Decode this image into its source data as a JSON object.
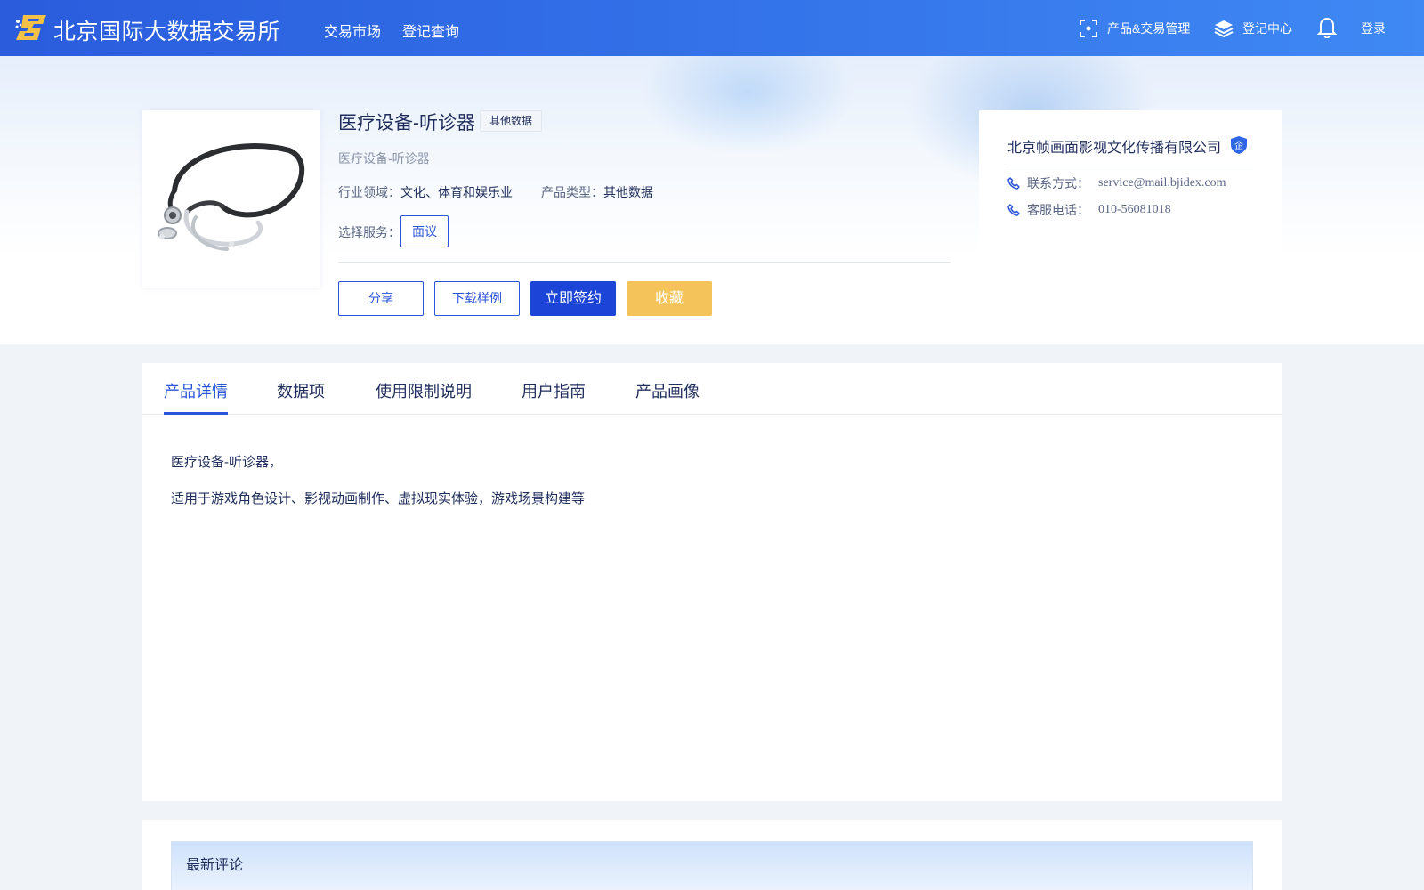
{
  "header": {
    "brand": "北京国际大数据交易所",
    "nav": [
      "交易市场",
      "登记查询"
    ],
    "product_mgmt": "产品&交易管理",
    "registry_center": "登记中心",
    "login": "登录",
    "colors": {
      "header_start": "#2a5cdc",
      "header_end": "#3f89f4"
    }
  },
  "product": {
    "title": "医疗设备-听诊器",
    "tag": "其他数据",
    "subtitle": "医疗设备-听诊器",
    "industry_label": "行业领域：",
    "industry_value": "文化、体育和娱乐业",
    "type_label": "产品类型：",
    "type_value": "其他数据",
    "service_label": "选择服务：",
    "service_option": "面议",
    "image_icon": "stethoscope-image"
  },
  "actions": {
    "share": "分享",
    "download_sample": "下载样例",
    "sign_now": "立即签约",
    "favorite": "收藏",
    "colors": {
      "primary": "#1c44d6",
      "favorite": "#f4c35a"
    }
  },
  "company": {
    "name": "北京帧画面影视文化传播有限公司",
    "badge": "企",
    "contact_label": "联系方式：",
    "contact_value": "service@mail.bjidex.com",
    "phone_label": "客服电话：",
    "phone_value": "010-56081018"
  },
  "tabs": [
    "产品详情",
    "数据项",
    "使用限制说明",
    "用户指南",
    "产品画像"
  ],
  "detail": {
    "line1": "医疗设备-听诊器，",
    "line2": "适用于游戏角色设计、影视动画制作、虚拟现实体验，游戏场景构建等"
  },
  "comments": {
    "title": "最新评论"
  }
}
